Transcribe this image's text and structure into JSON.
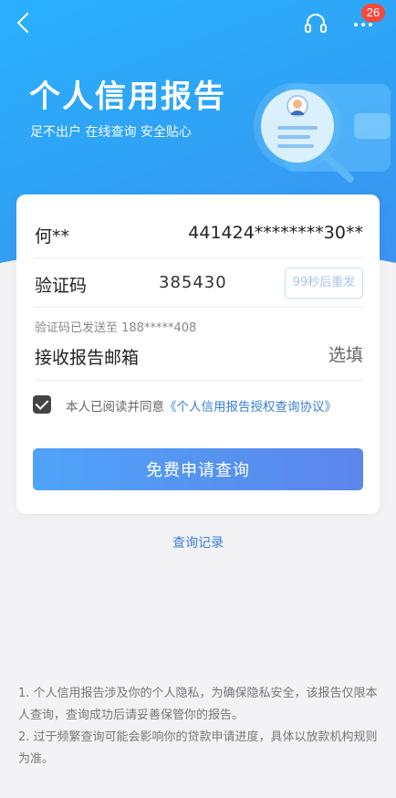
{
  "header": {
    "title": "个人信用报告",
    "subtitle": "足不出户 在线查询 安全贴心",
    "badge_count": "26"
  },
  "form": {
    "name": "何**",
    "id_number": "441424********30**",
    "verify_label": "验证码",
    "verify_code": "385430",
    "resend_label": "99秒后重发",
    "sent_tip": "验证码已发送至 188*****408",
    "email_label": "接收报告邮箱",
    "email_placeholder": "选填",
    "agreement_prefix": "本人已阅读并同意",
    "agreement_link": "《个人信用报告授权查询协议》",
    "agreement_checked": true,
    "submit_label": "免费申请查询"
  },
  "history_link": "查询记录",
  "notes": [
    "1. 个人信用报告涉及你的个人隐私，为确保隐私安全，该报告仅限本人查询，查询成功后请妥善保管你的报告。",
    "2. 过于频繁查询可能会影响你的贷款申请进度，具体以放款机构规则为准。"
  ],
  "colors": {
    "header_gradient_start": "#2ab0ff",
    "header_gradient_end": "#3d8ff0",
    "link": "#3a7fd8",
    "button_start": "#4fa3f8",
    "button_end": "#5c86ea",
    "badge": "#f04b3c"
  }
}
